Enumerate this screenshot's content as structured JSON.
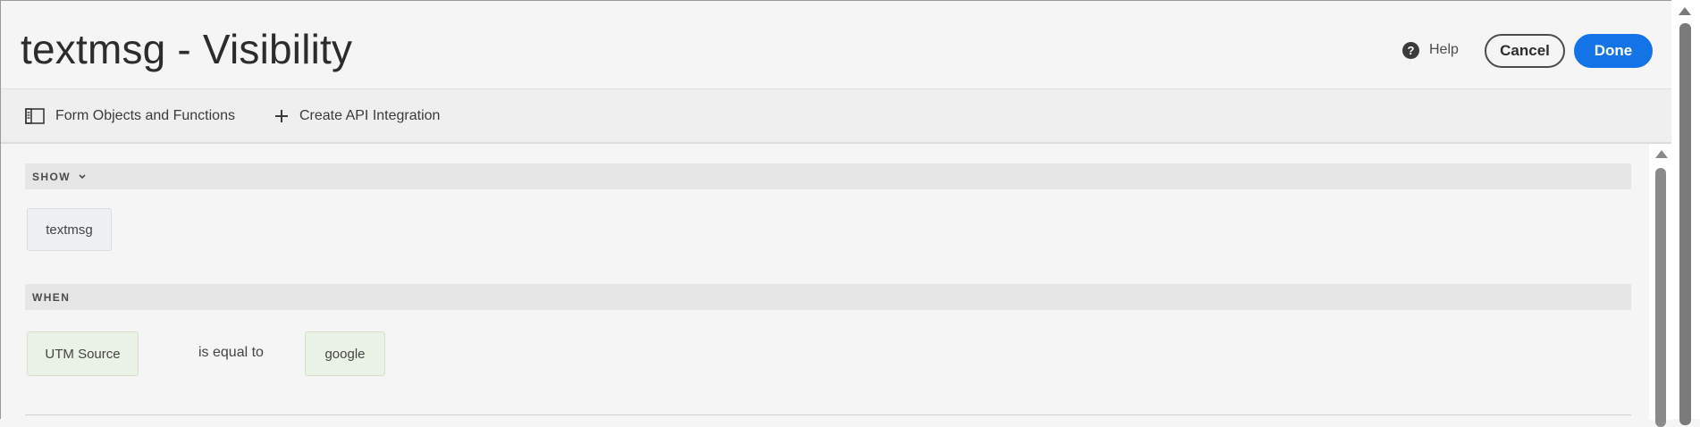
{
  "header": {
    "title": "textmsg - Visibility",
    "help_label": "Help",
    "cancel_label": "Cancel",
    "done_label": "Done",
    "accent_color": "#1473e6"
  },
  "toolbar": {
    "forms_label": "Form Objects and Functions",
    "forms_icon": "panel-icon",
    "api_label": "Create API Integration",
    "api_icon": "plus-icon"
  },
  "rule": {
    "show": {
      "label": "SHOW",
      "object": "textmsg"
    },
    "when": {
      "label": "WHEN",
      "field": "UTM Source",
      "operator": "is equal to",
      "value": "google"
    }
  }
}
